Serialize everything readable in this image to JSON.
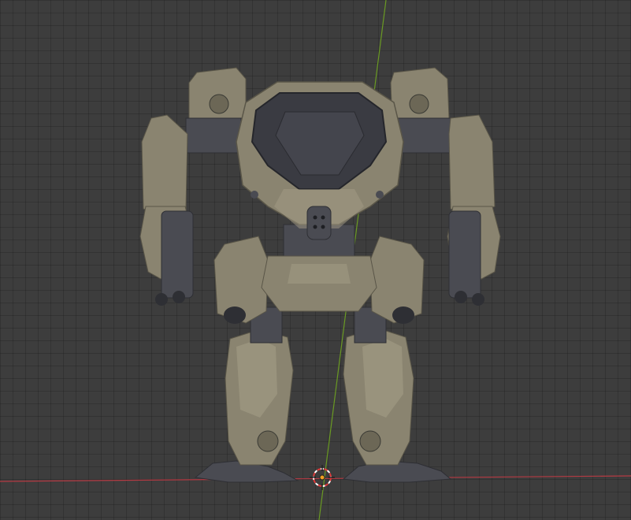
{
  "viewport": {
    "mode": "3D Viewport",
    "object": "mech-robot-model",
    "colors": {
      "background": "#3d3d3d",
      "grid_line": "#333333",
      "x_axis": "#b53a43",
      "y_axis": "#6a9a23",
      "armor": "#8a8470",
      "armor_light": "#a39c85",
      "armor_dark": "#6c6756",
      "joint": "#4a4b52",
      "cockpit": "#3a3b42",
      "cursor_red": "#e03a3a",
      "origin": "#f0a020"
    },
    "icons": {
      "cursor": "3d-cursor-icon",
      "origin": "origin-dot-icon"
    }
  }
}
